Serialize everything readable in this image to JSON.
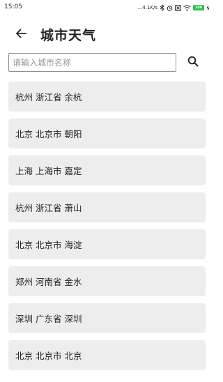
{
  "status_bar": {
    "time": "15:05",
    "speed": "...4.1K/s",
    "battery": "100",
    "icons": [
      "bluetooth-icon",
      "alarm-icon",
      "sim-icon",
      "wifi-icon",
      "battery-icon",
      "charging-icon"
    ]
  },
  "header": {
    "back_icon": "arrow-left-icon",
    "title": "城市天气"
  },
  "search": {
    "placeholder": "请输入城市名称",
    "value": "",
    "button_icon": "search-icon"
  },
  "cities": [
    {
      "label": "杭州 浙江省 余杭"
    },
    {
      "label": "北京 北京市 朝阳"
    },
    {
      "label": "上海 上海市 嘉定"
    },
    {
      "label": "杭州 浙江省 萧山"
    },
    {
      "label": "北京 北京市 海淀"
    },
    {
      "label": "郑州 河南省 金水"
    },
    {
      "label": "深圳 广东省 深圳"
    },
    {
      "label": "北京 北京市 北京"
    }
  ]
}
